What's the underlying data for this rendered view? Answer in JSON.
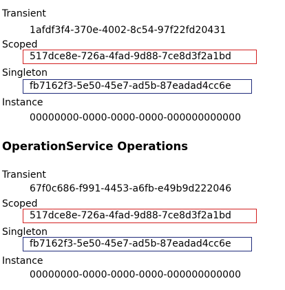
{
  "group1": {
    "transient_label": "Transient",
    "transient_value": "1afdf3f4-370e-4002-8c54-97f22fd20431",
    "scoped_label": "Scoped",
    "scoped_value": "517dce8e-726a-4fad-9d88-7ce8d3f2a1bd",
    "singleton_label": "Singleton",
    "singleton_value": "fb7162f3-5e50-45e7-ad5b-87eadad4cc6e",
    "instance_label": "Instance",
    "instance_value": "00000000-0000-0000-0000-000000000000"
  },
  "heading": "OperationService Operations",
  "group2": {
    "transient_label": "Transient",
    "transient_value": "67f0c686-f991-4453-a6fb-e49b9d222046",
    "scoped_label": "Scoped",
    "scoped_value": "517dce8e-726a-4fad-9d88-7ce8d3f2a1bd",
    "singleton_label": "Singleton",
    "singleton_value": "fb7162f3-5e50-45e7-ad5b-87eadad4cc6e",
    "instance_label": "Instance",
    "instance_value": "00000000-0000-0000-0000-000000000000"
  },
  "colors": {
    "scoped_box": "#d21e1e",
    "singleton_box": "#1e2a7a"
  }
}
